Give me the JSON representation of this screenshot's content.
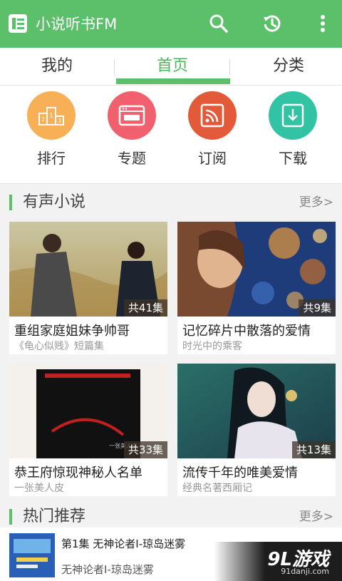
{
  "app": {
    "title": "小说听书FM"
  },
  "tabs": [
    {
      "label": "我的"
    },
    {
      "label": "首页",
      "active": true
    },
    {
      "label": "分类"
    }
  ],
  "quick": [
    {
      "label": "排行",
      "icon": "ranking-podium-icon",
      "color": "#f7b055"
    },
    {
      "label": "专题",
      "icon": "topic-window-icon",
      "color": "#f0606f"
    },
    {
      "label": "订阅",
      "icon": "subscribe-rss-icon",
      "color": "#e25a3a"
    },
    {
      "label": "下载",
      "icon": "download-icon",
      "color": "#31c3a4"
    }
  ],
  "section_audio": {
    "title": "有声小说",
    "more": "更多>"
  },
  "cards": [
    {
      "title": "重组家庭姐妹争帅哥",
      "subtitle": "《龟心似贱》短篇集",
      "badge": "共41集"
    },
    {
      "title": "记忆碎片中散落的爱情",
      "subtitle": "时光中的乘客",
      "badge": "共9集"
    },
    {
      "title": "恭王府惊现神秘人名单",
      "subtitle": "一张美人皮",
      "badge": "共33集",
      "cover_text": "一张美人皮"
    },
    {
      "title": "流传千年的唯美爱情",
      "subtitle": "经典名著西厢记",
      "badge": "共13集"
    }
  ],
  "section_hot": {
    "title": "热门推荐",
    "more": "更多>"
  },
  "recommend": {
    "line1": "第1集  无神论者Ⅰ-琼岛迷雾",
    "line2": "无神论者Ⅰ-琼岛迷雾"
  },
  "watermark": {
    "brand": "9L游戏",
    "url": "91danji.com"
  },
  "colors": {
    "primary": "#5cc06a",
    "background": "#f2f2f2"
  }
}
